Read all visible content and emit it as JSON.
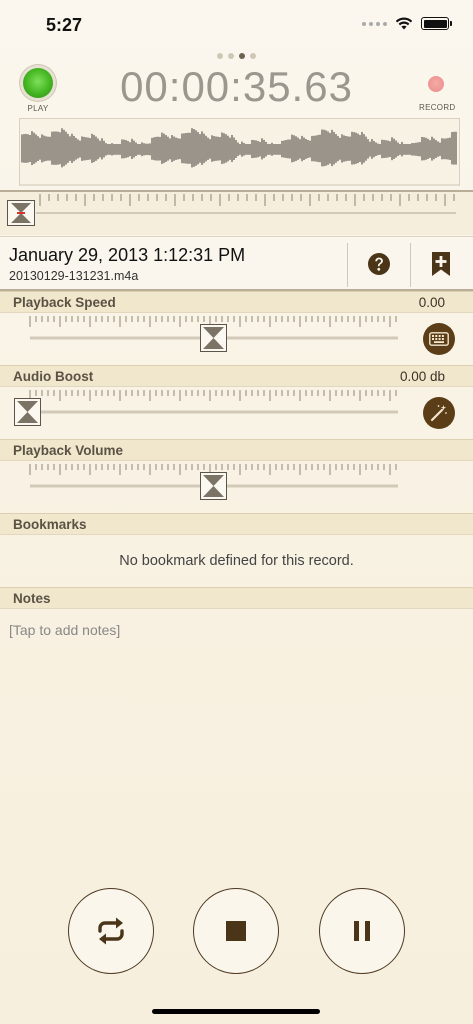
{
  "status_bar": {
    "time": "5:27"
  },
  "header": {
    "play_label": "PLAY",
    "record_label": "RECORD",
    "timer": "00:00:35.63",
    "pages": 4,
    "active_page": 2
  },
  "record": {
    "date": "January 29, 2013 1:12:31 PM",
    "filename": "20130129-131231.m4a"
  },
  "sections": {
    "playback_speed": {
      "title": "Playback Speed",
      "value": "0.00",
      "level": 0.5
    },
    "audio_boost": {
      "title": "Audio Boost",
      "value": "0.00 db",
      "level": 0.0
    },
    "playback_volume": {
      "title": "Playback Volume",
      "level": 0.5
    },
    "bookmarks": {
      "title": "Bookmarks",
      "empty_message": "No bookmark defined for this record."
    },
    "notes": {
      "title": "Notes",
      "placeholder": "[Tap to add notes]"
    }
  },
  "colors": {
    "accent_brown": "#5b3d18",
    "play_green": "#44b521",
    "record_red": "#e88c88",
    "section_bg": "#f1e7cd"
  },
  "icons": {
    "help": "question-circle-icon",
    "bookmark_add": "bookmark-plus-icon",
    "keyboard": "keyboard-icon",
    "magic": "magic-wand-icon",
    "repeat": "repeat-icon",
    "stop": "stop-icon",
    "pause": "pause-icon"
  }
}
